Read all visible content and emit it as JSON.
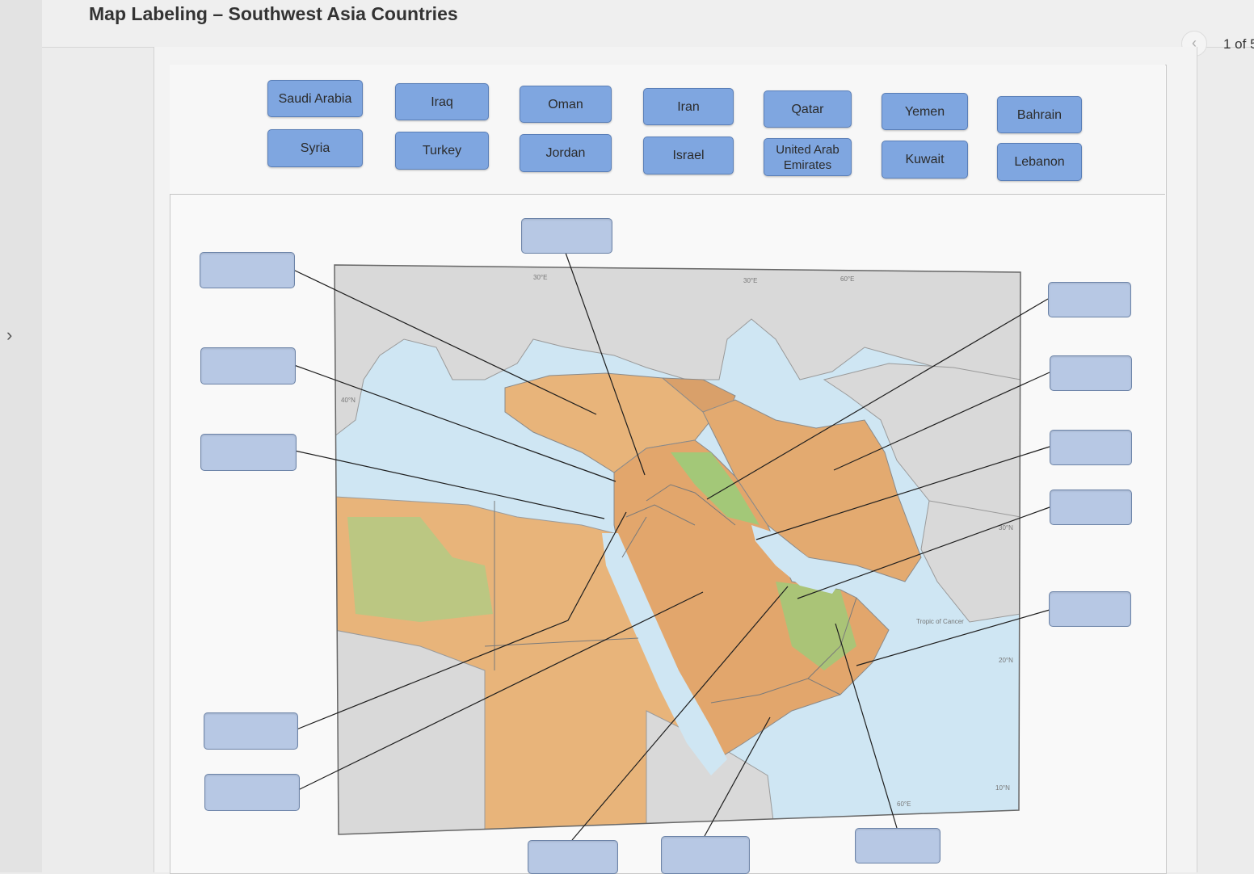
{
  "page": {
    "title": "Map Labeling – Southwest Asia Countries",
    "pager": {
      "prev_icon": "chevron-left-icon",
      "count": "1 of 5"
    },
    "sidebar_toggle_icon": "chevron-right-icon"
  },
  "word_bank": [
    "Saudi Arabia",
    "Iraq",
    "Oman",
    "Iran",
    "Qatar",
    "Yemen",
    "Bahrain",
    "Syria",
    "Turkey",
    "Jordan",
    "Israel",
    "United Arab Emirates",
    "Kuwait",
    "Lebanon"
  ],
  "map": {
    "labels": {
      "lon_30": "30°E",
      "lon_45": "30°E",
      "lon_60": "60°E",
      "lat_40": "40°N",
      "lat_30": "30°N",
      "lat_20": "20°N",
      "lat_10": "10°N",
      "tropic": "Tropic of Cancer",
      "lon_60b": "60°E"
    }
  },
  "colors": {
    "chip": "#7fa6e0",
    "dropzone": "#b7c8e4",
    "water": "#cfe6f3",
    "land_other": "#d9d9d9",
    "desert": "#e8b47a",
    "lowland": "#9ccc7a"
  }
}
